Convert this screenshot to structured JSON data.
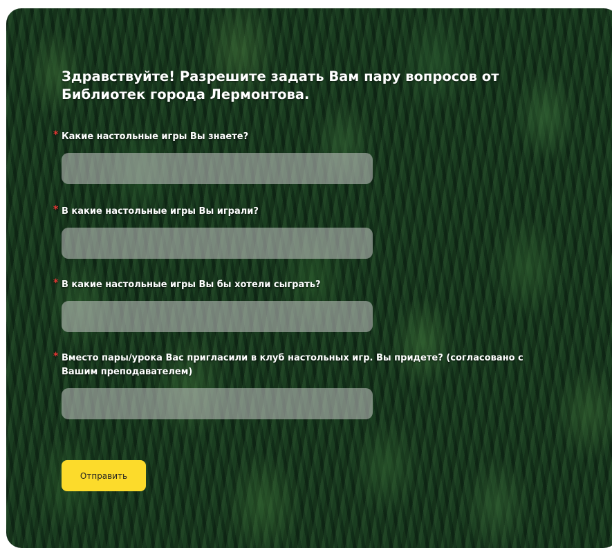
{
  "form": {
    "title": "Здравствуйте! Разрешите задать Вам пару вопросов от Библиотек города Лермонтова.",
    "required_mark": "*",
    "questions": [
      {
        "label": "Какие настольные игры Вы знаете?",
        "value": ""
      },
      {
        "label": "В какие настольные игры Вы играли?",
        "value": ""
      },
      {
        "label": "В какие настольные игры Вы бы хотели сыграть?",
        "value": ""
      },
      {
        "label": "Вместо пары/урока Вас пригласили в клуб настольных игр. Вы придете? (согласовано с Вашим преподавателем)",
        "value": ""
      }
    ],
    "submit_label": "Отправить"
  },
  "colors": {
    "button": "#fcdb2b",
    "required": "#e53935",
    "text": "#ffffff"
  }
}
